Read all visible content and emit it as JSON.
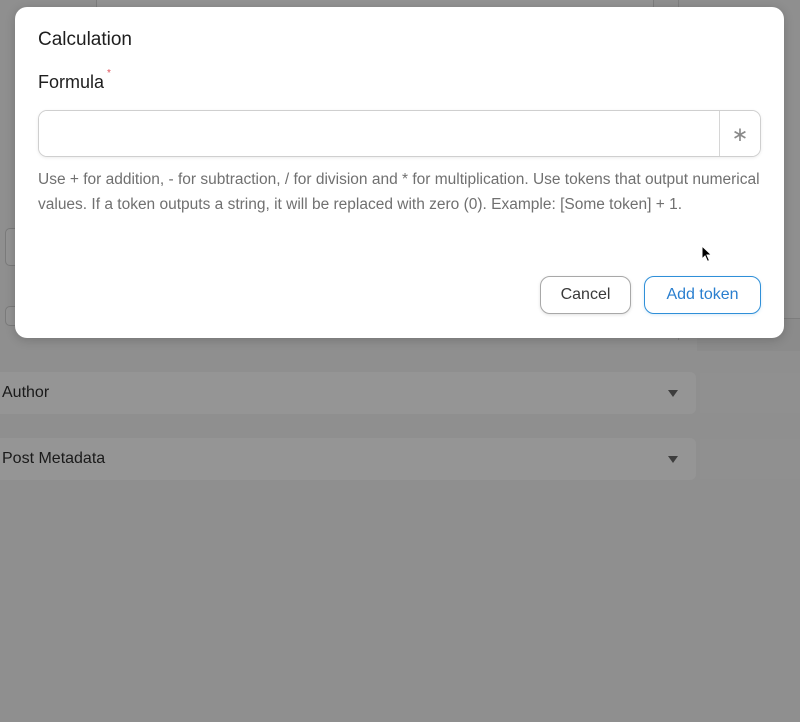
{
  "background": {
    "panels": [
      {
        "label": "Author"
      },
      {
        "label": "Post Metadata"
      }
    ]
  },
  "modal": {
    "title": "Calculation",
    "formula_label": "Formula",
    "required_mark": "*",
    "formula_value": "",
    "formula_placeholder": "",
    "token_button_glyph": "∗",
    "help_text": "Use + for addition, - for subtraction, / for division and * for multiplication. Use tokens that output numerical values. If a token outputs a string, it will be replaced with zero (0). Example: [Some token] + 1.",
    "cancel_label": "Cancel",
    "add_label": "Add token"
  },
  "colors": {
    "accent": "#2f8fd8",
    "required": "#e0545c",
    "overlay": "#8f8f8f"
  },
  "icons": {
    "token_button": "asterisk-icon",
    "panel_toggle": "caret-down-icon",
    "pointer": "mouse-pointer-icon"
  }
}
